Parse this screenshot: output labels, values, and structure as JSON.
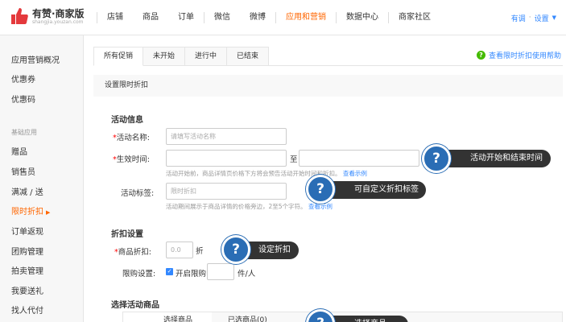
{
  "brand": {
    "title": "有赞·商家版",
    "subtitle": "shangjia.youzan.com"
  },
  "nav": {
    "items": [
      "店铺",
      "商品",
      "订单",
      "微信",
      "微博",
      "应用和营销",
      "数据中心",
      "商家社区"
    ],
    "active": "应用和营销",
    "right_user": "有调",
    "right_settings": "设置"
  },
  "sidebar": {
    "items": [
      "应用营销概况",
      "优惠券",
      "优惠码"
    ],
    "group_label": "基础应用",
    "group_items": [
      "赠品",
      "销售员",
      "满减 / 送",
      "限时折扣",
      "订单返现",
      "团购管理",
      "拍卖管理",
      "我要送礼",
      "找人代付"
    ]
  },
  "tabs": [
    "所有促销",
    "未开始",
    "进行中",
    "已结束"
  ],
  "help_link": "查看限时折扣使用帮助",
  "section_title": "设置限时折扣",
  "activity": {
    "title": "活动信息",
    "name_label": "活动名称:",
    "name_placeholder": "请填写活动名称",
    "time_label": "生效时间:",
    "time_sep": "至",
    "time_hint": "活动开始前，商品详情页价格下方将会预告活动开始时间和折扣。",
    "time_hint_link": "查看示例",
    "tag_label": "活动标签:",
    "tag_placeholder": "限时折扣",
    "tag_hint": "活动期间展示于商品详情的价格旁边，2至5个字符。",
    "tag_hint_link": "查看示例"
  },
  "discount": {
    "title": "折扣设置",
    "label": "商品折扣:",
    "value": "0.0",
    "unit": "折",
    "limit_label": "限购设置:",
    "limit_check": "开启限购",
    "limit_unit": "件/人"
  },
  "products": {
    "title": "选择活动商品",
    "tab_1": "选择商品",
    "tab_2": "已选商品(0)"
  },
  "callouts": {
    "time": "活动开始和结束时间",
    "tag": "可自定义折扣标签",
    "discount": "设定折扣",
    "products": "选择商品"
  },
  "colors": {
    "accent": "#ff6600",
    "link": "#3388ff",
    "callout_ring": "#2a6db5"
  },
  "icons": {
    "logo": "thumbs-up-icon",
    "help": "question-circle-icon",
    "callout": "question-mark-icon"
  }
}
